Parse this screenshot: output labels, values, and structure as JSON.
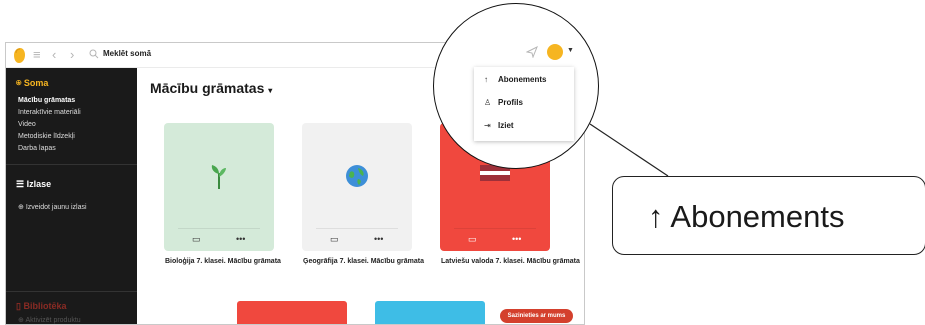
{
  "topbar": {
    "search_placeholder": "Meklēt somā"
  },
  "sidebar": {
    "soma": {
      "label": "Soma",
      "items": [
        "Mācību grāmatas",
        "Interaktīvie materiāli",
        "Video",
        "Metodiskie līdzekļi",
        "Darba lapas"
      ]
    },
    "izlase": {
      "label": "Izlase",
      "create": "Izveidot jaunu izlasi"
    },
    "biblioteka": {
      "label": "Bibliotēka",
      "activate": "Aktivizēt produktu"
    }
  },
  "main": {
    "title": "Mācību grāmatas",
    "cards": [
      {
        "title": "Bioloģija 7. klasei. Mācību grāmata",
        "color": "#d4ead9",
        "icon": "seedling-icon"
      },
      {
        "title": "Ģeogrāfija 7. klasei. Mācību grāmata",
        "color": "#f1f1f1",
        "icon": "globe-icon"
      },
      {
        "title": "Latviešu valoda 7. klasei. Mācību grāmata",
        "color": "#f0483e",
        "icon": "latvia-flag-icon"
      }
    ],
    "contact_button": "Sazinieties ar mums"
  },
  "dropdown": {
    "items": [
      "Abonements",
      "Profils",
      "Iziet"
    ]
  },
  "callout": {
    "label": "Abonements"
  }
}
